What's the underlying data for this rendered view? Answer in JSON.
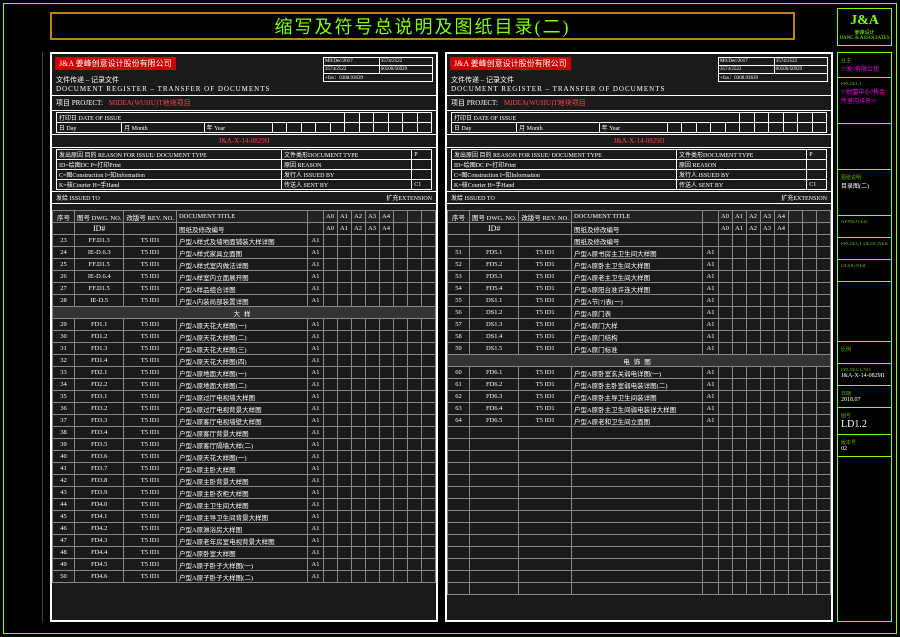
{
  "title": "缩写及符号总说明及图纸目录(二)",
  "logo": {
    "ja": "J&A",
    "sub": "姜峰设计",
    "sub2": "JIANG & ASSOCIATES"
  },
  "company_header": "姜峰创意设计股份有限公司",
  "doc_reg_label": "文件传递 – 记录文件",
  "doc_reg_en": "DOCUMENT REGISTER – TRANSFER OF DOCUMENTS",
  "project_label": "项目 PROJECT:",
  "project_red": "MIDEA(WUHU)T地块项目",
  "jobno": "J&A-X-14-0829II",
  "meta": {
    "r1": "M0:Dec/2017",
    "r2": "3574/2522",
    "r3": "3574/2522",
    "r4": "00500/50929",
    "fax": "+fax：0308.93639",
    "date_lbl": "打印日 DATE OF ISSUE",
    "day": "日 Day",
    "month": "月 Month",
    "year": "年 Year",
    "doctype": "文件类形DOCUMENT TYPE",
    "p": "P",
    "reason": "原因 REASON",
    "issued": "发行人 ISSUED BY",
    "sent": "传送人 SENT BY"
  },
  "reason_line": "发出原因 目的 REASON FOR ISSUE/ DOCUMENT TYPE",
  "reason_codes": "ID=绘图DC P=打印Print",
  "reason_codes2": "C=图Construction I=知Information",
  "reason_codes3": "K=核Courier H=手Hand",
  "issued_to": "发给 ISSUED TO",
  "extension": "扩充EXTENSION",
  "th": {
    "num": "序号",
    "title": "DOCUMENT TITLE",
    "dwg": "图号 DWG. NO.",
    "rev": "改版号 REV. NO.",
    "fmt": ""
  },
  "rev_head": [
    "A0",
    "A1",
    "A2",
    "A3",
    "A4"
  ],
  "id_row": {
    "num": "",
    "sym": "ID#",
    "title": "图纸及修改编号",
    "fmt": ""
  },
  "left_rows": [
    {
      "n": "23",
      "d": "FF.D1.3",
      "r": "T5 ID1",
      "t": "户型A样式及墙地面铺装大样详图",
      "f": "A1"
    },
    {
      "n": "24",
      "d": "IE-D.6.3",
      "r": "T5 ID1",
      "t": "户型A样式家具立面图",
      "f": "A1"
    },
    {
      "n": "25",
      "d": "FF.D1.5",
      "r": "T5 ID1",
      "t": "户型A样式室内做法详图",
      "f": "A1"
    },
    {
      "n": "26",
      "d": "IE-D.6.4",
      "r": "T5 ID1",
      "t": "户型A样室内立面展开图",
      "f": "A1"
    },
    {
      "n": "27",
      "d": "FF.D1.5",
      "r": "T5 ID1",
      "t": "户型A样品组合详图",
      "f": "A1"
    },
    {
      "n": "28",
      "d": "IE-D.5",
      "r": "T5 ID1",
      "t": "户型A内装局部装置详图",
      "f": "A1"
    },
    {
      "section": "大样"
    },
    {
      "n": "29",
      "d": "FD1.1",
      "r": "T5 ID1",
      "t": "户型A原天花大样图(一)",
      "f": "A1"
    },
    {
      "n": "30",
      "d": "FD1.2",
      "r": "T5 ID1",
      "t": "户型A原天花大样图(二)",
      "f": "A1"
    },
    {
      "n": "31",
      "d": "FD1.3",
      "r": "T5 ID1",
      "t": "户型A原天花大样图(三)",
      "f": "A1"
    },
    {
      "n": "32",
      "d": "FD1.4",
      "r": "T5 ID1",
      "t": "户型A原天花大样图(四)",
      "f": "A1"
    },
    {
      "n": "33",
      "d": "FD2.1",
      "r": "T5 ID1",
      "t": "户型A原地面大样图(一)",
      "f": "A1"
    },
    {
      "n": "34",
      "d": "FD2.2",
      "r": "T5 ID1",
      "t": "户型A原地面大样图(二)",
      "f": "A1"
    },
    {
      "n": "35",
      "d": "FD3.1",
      "r": "T5 ID1",
      "t": "户型A原过厅电视墙大样图",
      "f": "A1"
    },
    {
      "n": "36",
      "d": "FD3.2",
      "r": "T5 ID1",
      "t": "户型A原过厅电视背景大样图",
      "f": "A1"
    },
    {
      "n": "37",
      "d": "FD3.3",
      "r": "T5 ID1",
      "t": "户型A原客厅电视墙壁大样图",
      "f": "A1"
    },
    {
      "n": "38",
      "d": "FD3.4",
      "r": "T5 ID1",
      "t": "户型A原客厅背景大样图",
      "f": "A1"
    },
    {
      "n": "39",
      "d": "FD3.5",
      "r": "T5 ID1",
      "t": "户型A原客厅隔墙大样(二)",
      "f": "A1"
    },
    {
      "n": "40",
      "d": "FD3.6",
      "r": "T5 ID1",
      "t": "户型A原天花大样图(一)",
      "f": "A1"
    },
    {
      "n": "41",
      "d": "FD3.7",
      "r": "T5 ID1",
      "t": "户型A原主卧大样图",
      "f": "A1"
    },
    {
      "n": "42",
      "d": "FD3.8",
      "r": "T5 ID1",
      "t": "户型A原主卧背景大样图",
      "f": "A1"
    },
    {
      "n": "43",
      "d": "FD3.9",
      "r": "T5 ID1",
      "t": "户型A原主卧衣柜大样图",
      "f": "A1"
    },
    {
      "n": "44",
      "d": "FD4.0",
      "r": "T5 ID1",
      "t": "户型A原主卫生间大样图",
      "f": "A1"
    },
    {
      "n": "45",
      "d": "FD4.1",
      "r": "T5 ID1",
      "t": "户型A原主导卫生间背景大样图",
      "f": "A1"
    },
    {
      "n": "46",
      "d": "FD4.2",
      "r": "T5 ID1",
      "t": "户型A原淋浴房大样图",
      "f": "A1"
    },
    {
      "n": "47",
      "d": "FD4.3",
      "r": "T5 ID1",
      "t": "户型A原老年房室电视背景大样图",
      "f": "A1"
    },
    {
      "n": "48",
      "d": "FD4.4",
      "r": "T5 ID1",
      "t": "户型A原卧室大样图",
      "f": "A1"
    },
    {
      "n": "49",
      "d": "FD4.5",
      "r": "T5 ID1",
      "t": "户型A原子卧子大样图(一)",
      "f": "A1"
    },
    {
      "n": "50",
      "d": "FD4.6",
      "r": "T5 ID1",
      "t": "户型A原子卧子大样图(二)",
      "f": "A1"
    }
  ],
  "right_rows": [
    {
      "n": "",
      "sym": "ID#",
      "t": "图纸及修改编号",
      "f": ""
    },
    {
      "n": "51",
      "d": "FD5.1",
      "r": "T5 ID1",
      "t": "户型A原书房主卫生间大样图",
      "f": "A1"
    },
    {
      "n": "52",
      "d": "FD5.2",
      "r": "T5 ID1",
      "t": "户型A原卧主卫生间大样图",
      "f": "A1"
    },
    {
      "n": "53",
      "d": "FD5.3",
      "r": "T5 ID1",
      "t": "户型A原老主卫生间大样图",
      "f": "A1"
    },
    {
      "n": "54",
      "d": "FD5.4",
      "r": "T5 ID1",
      "t": "户型A原阳台准许连大样图",
      "f": "A1"
    },
    {
      "n": "55",
      "d": "DS1.1",
      "r": "T5 ID1",
      "t": "户型A节[?]表(一)",
      "f": "A1"
    },
    {
      "n": "56",
      "d": "DS1.2",
      "r": "T5 ID1",
      "t": "户型A原门表",
      "f": "A1"
    },
    {
      "n": "57",
      "d": "DS1.3",
      "r": "T5 ID1",
      "t": "户型A原门大样",
      "f": "A1"
    },
    {
      "n": "58",
      "d": "DS1.4",
      "r": "T5 ID1",
      "t": "户型A原门结构",
      "f": "A1"
    },
    {
      "n": "59",
      "d": "DS1.5",
      "r": "T5 ID1",
      "t": "户型A原门标准",
      "f": "A1"
    },
    {
      "section": "电饰图"
    },
    {
      "n": "60",
      "d": "FD6.1",
      "r": "T5 ID1",
      "t": "户型A原卧室玄关弱电详图(一)",
      "f": "A1"
    },
    {
      "n": "61",
      "d": "FD6.2",
      "r": "T5 ID1",
      "t": "户型A原卧主卧室弱电装详图(二)",
      "f": "A1"
    },
    {
      "n": "62",
      "d": "FD6.3",
      "r": "T5 ID1",
      "t": "户型A原卧主导卫生间装详图",
      "f": "A1"
    },
    {
      "n": "63",
      "d": "FD6.4",
      "r": "T5 ID1",
      "t": "户型A原卧主卫生间弱电装详大样图",
      "f": "A1"
    },
    {
      "n": "64",
      "d": "FD6.5",
      "r": "T5 ID1",
      "t": "户型A原老和卫生间立面图",
      "f": "A1"
    },
    {
      "n": "",
      "d": "",
      "r": "",
      "t": "",
      "f": ""
    },
    {
      "n": "",
      "d": "",
      "r": "",
      "t": "",
      "f": ""
    },
    {
      "n": "",
      "d": "",
      "r": "",
      "t": "",
      "f": ""
    },
    {
      "n": "",
      "d": "",
      "r": "",
      "t": "",
      "f": ""
    },
    {
      "n": "",
      "d": "",
      "r": "",
      "t": "",
      "f": ""
    },
    {
      "n": "",
      "d": "",
      "r": "",
      "t": "",
      "f": ""
    },
    {
      "n": "",
      "d": "",
      "r": "",
      "t": "",
      "f": ""
    },
    {
      "n": "",
      "d": "",
      "r": "",
      "t": "",
      "f": ""
    },
    {
      "n": "",
      "d": "",
      "r": "",
      "t": "",
      "f": ""
    },
    {
      "n": "",
      "d": "",
      "r": "",
      "t": "",
      "f": ""
    },
    {
      "n": "",
      "d": "",
      "r": "",
      "t": "",
      "f": ""
    },
    {
      "n": "",
      "d": "",
      "r": "",
      "t": "",
      "f": ""
    },
    {
      "n": "",
      "d": "",
      "r": "",
      "t": "",
      "f": ""
    },
    {
      "n": "",
      "d": "",
      "r": "",
      "t": "",
      "f": ""
    }
  ],
  "tb": {
    "client": "??发?有限公司",
    "client_lbl": "业主",
    "proj": "??财富中心7栋会所室内详名??",
    "proj_lbl": "PROJECT",
    "sheet": "目录图(二)",
    "sheet_lbl": "图纸说明",
    "chk": "APPROVED",
    "lead": "PROJECT DESIGNER",
    "designer": "DESIGNER",
    "scale": "比例",
    "scale_v": "",
    "job": "J&A-X-14-0829II",
    "job_lbl": "PROJECT NO",
    "date": "2018.07",
    "date_lbl": "日期",
    "dwg": "LD1.2",
    "dwg_lbl": "图号",
    "rev": "02",
    "rev_lbl": "版本号"
  }
}
